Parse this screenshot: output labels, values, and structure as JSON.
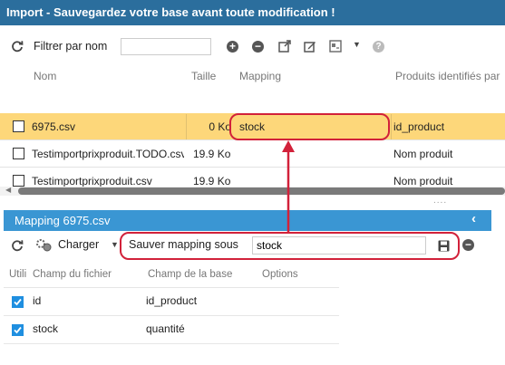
{
  "window": {
    "title": "Import - Sauvegardez votre base avant toute modification !"
  },
  "toolbar": {
    "filter_label": "Filtrer par nom",
    "filter_value": "",
    "icons": [
      "refresh-icon",
      "add-icon",
      "remove-icon",
      "export-icon",
      "edit-icon",
      "layout-icon",
      "dropdown-icon",
      "help-icon"
    ]
  },
  "grid": {
    "columns": [
      "Nom",
      "Taille",
      "Mapping",
      "Produits identifiés par"
    ],
    "rows": [
      {
        "name": "6975.csv",
        "size": "0 Ko",
        "mapping": "stock",
        "id_by": "id_product",
        "selected": true
      },
      {
        "name": "Testimportprixproduit.TODO.csv",
        "size": "19.9 Ko",
        "mapping": "",
        "id_by": "Nom produit",
        "selected": false
      },
      {
        "name": "Testimportprixproduit.csv",
        "size": "19.9 Ko",
        "mapping": "",
        "id_by": "Nom produit",
        "selected": false
      }
    ]
  },
  "splitter": "....",
  "mapping_panel": {
    "title": "Mapping 6975.csv",
    "collapse_symbol": "‹",
    "load_label": "Charger",
    "save_label": "Sauver mapping sous",
    "save_value": "stock",
    "columns": [
      "Utili",
      "Champ du fichier",
      "Champ de la base",
      "Options"
    ],
    "rows": [
      {
        "file_field": "id",
        "db_field": "id_product",
        "checked": true
      },
      {
        "file_field": "stock",
        "db_field": "quantité",
        "checked": true
      }
    ]
  },
  "colors": {
    "title_bar": "#2b6e9d",
    "panel_header": "#3a96d3",
    "selected_row": "#fdd77a",
    "highlight": "#d2213a",
    "checkbox_checked": "#1f8fe0"
  }
}
